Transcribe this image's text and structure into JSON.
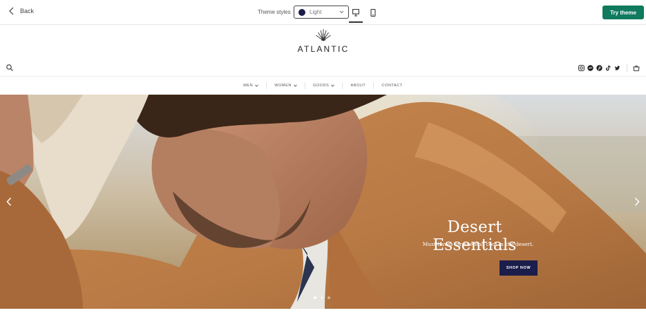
{
  "editor": {
    "back_label": "Back",
    "theme_styles_label": "Theme styles",
    "style_select": {
      "value": "Light",
      "swatch_color": "#1b1d4b"
    },
    "device_modes": [
      "desktop",
      "mobile"
    ],
    "active_device": "desktop",
    "try_button_label": "Try theme",
    "try_button_color": "#0f7a5d"
  },
  "store": {
    "logo_text": "ATLANTIC",
    "nav": [
      {
        "label": "MEN",
        "has_dropdown": true
      },
      {
        "label": "WOMEN",
        "has_dropdown": true
      },
      {
        "label": "GOODS",
        "has_dropdown": true
      },
      {
        "label": "ABOUT",
        "has_dropdown": false
      },
      {
        "label": "CONTACT",
        "has_dropdown": false
      }
    ],
    "social_icons": [
      "instagram-icon",
      "facebook-messenger-icon",
      "pinterest-icon",
      "tiktok-icon",
      "twitter-icon"
    ]
  },
  "hero": {
    "title": "Desert Essentials",
    "subtitle": "Must-haves for keeping cool in the desert.",
    "button_label": "SHOP NOW",
    "button_color": "#1b1d4b",
    "slide_count": 3,
    "active_slide": 1
  }
}
